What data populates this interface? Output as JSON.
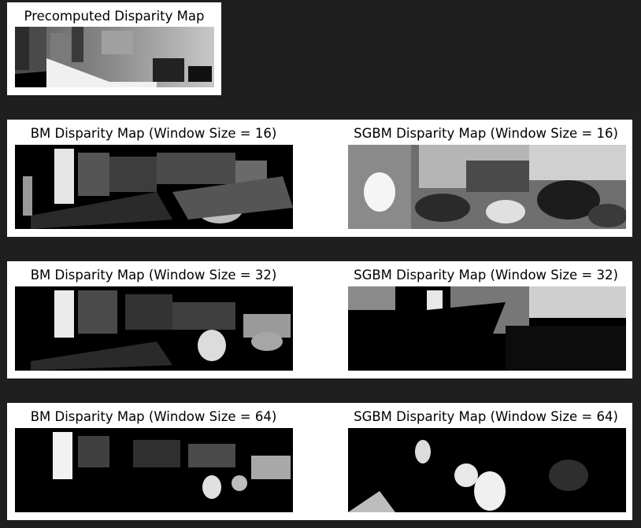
{
  "colors": {
    "background": "#1f1f1f",
    "panel": "#ffffff",
    "image_dark": "#000000"
  },
  "figures": {
    "precomputed": {
      "title": "Precomputed Disparity Map"
    },
    "bm16": {
      "title": "BM Disparity Map (Window Size = 16)"
    },
    "sgbm16": {
      "title": "SGBM Disparity Map (Window Size = 16)"
    },
    "bm32": {
      "title": "BM Disparity Map (Window Size = 32)"
    },
    "sgbm32": {
      "title": "SGBM Disparity Map (Window Size = 32)"
    },
    "bm64": {
      "title": "BM Disparity Map (Window Size = 64)"
    },
    "sgbm64": {
      "title": "SGBM Disparity Map (Window Size = 64)"
    }
  }
}
